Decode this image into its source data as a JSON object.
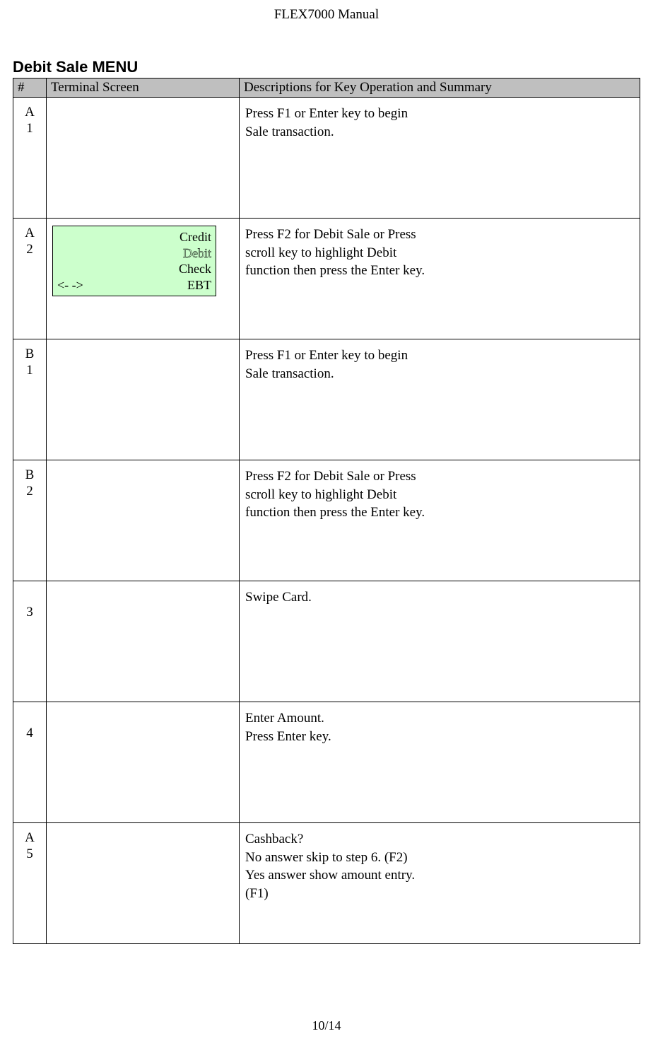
{
  "header": "FLEX7000 Manual",
  "section_title": "Debit Sale MENU",
  "table": {
    "headers": {
      "num": "#",
      "screen": "Terminal Screen",
      "desc": "Descriptions for Key Operation and Summary"
    },
    "rows": [
      {
        "id_line1": "A",
        "id_line2": "1",
        "has_terminal": false,
        "desc_lines": [
          "Press F1 or Enter key to begin",
          "Sale transaction."
        ]
      },
      {
        "id_line1": "A",
        "id_line2": "2",
        "has_terminal": true,
        "terminal": {
          "line1": "Credit",
          "line2": "Debit",
          "line3": "Check",
          "line4_left": "<-    ->",
          "line4_right": "EBT"
        },
        "desc_lines": [
          "Press F2 for Debit Sale or Press",
          "scroll key to highlight Debit",
          "function then press the Enter key."
        ]
      },
      {
        "id_line1": "B",
        "id_line2": "1",
        "has_terminal": false,
        "desc_lines": [
          "Press F1 or Enter key to begin",
          "Sale transaction."
        ]
      },
      {
        "id_line1": "B",
        "id_line2": "2",
        "has_terminal": false,
        "desc_lines": [
          "Press F2 for Debit Sale or Press",
          "scroll key to highlight Debit",
          "function then press the Enter key."
        ]
      },
      {
        "id_line1": "",
        "id_line2": "3",
        "has_terminal": false,
        "desc_lines": [
          "Swipe Card."
        ]
      },
      {
        "id_line1": "",
        "id_line2": "4",
        "has_terminal": false,
        "desc_lines": [
          "Enter Amount.",
          "Press Enter key."
        ]
      },
      {
        "id_line1": "A",
        "id_line2": "5",
        "has_terminal": false,
        "desc_lines": [
          "Cashback?",
          "No answer skip to step 6. (F2)",
          "Yes answer show amount entry.",
          " (F1)"
        ]
      }
    ]
  },
  "footer": "10/14"
}
